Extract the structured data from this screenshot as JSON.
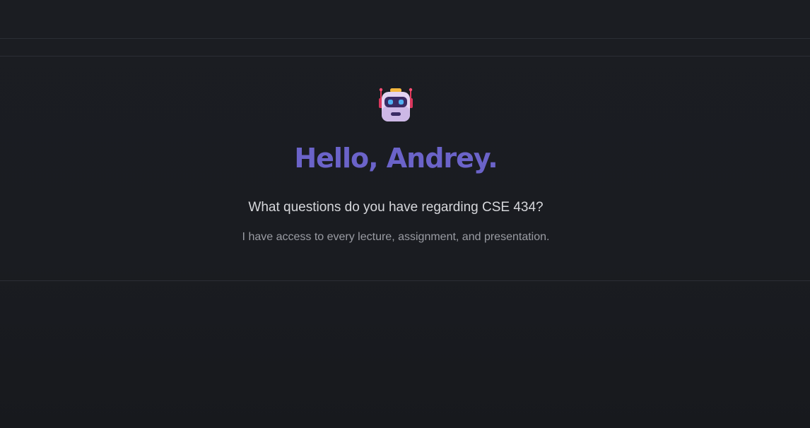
{
  "welcome": {
    "icon": "robot-icon",
    "greeting": "Hello, Andrey.",
    "question": "What questions do you have regarding CSE 434?",
    "subtext": "I have access to every lecture, assignment, and presentation."
  },
  "colors": {
    "background": "#1a1c21",
    "greeting": "#6b63c9",
    "divider": "#2b2e35"
  }
}
